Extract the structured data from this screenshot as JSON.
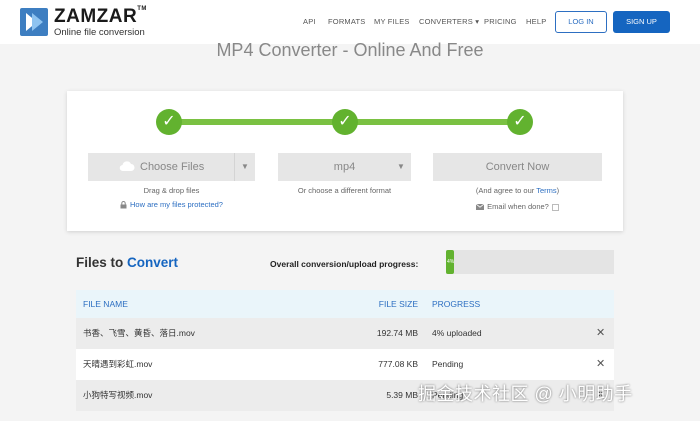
{
  "header": {
    "brand": "ZAMZAR",
    "trademark": "TM",
    "tagline": "Online file conversion",
    "nav": [
      {
        "label": "API"
      },
      {
        "label": "FORMATS"
      },
      {
        "label": "MY FILES"
      },
      {
        "label": "CONVERTERS ▾"
      },
      {
        "label": "PRICING"
      },
      {
        "label": "HELP"
      }
    ],
    "login_label": "LOG IN",
    "signup_label": "SIGN UP",
    "accent_color": "#1565c0"
  },
  "page_title": "MP4 Converter - Online And Free",
  "converter": {
    "choose_files_label": "Choose Files",
    "drag_hint": "Drag & drop files",
    "protected_link": "How are my files protected?",
    "format_value": "mp4",
    "format_hint": "Or choose a different format",
    "convert_label": "Convert Now",
    "terms_prefix": "(And agree to our ",
    "terms_link": "Terms",
    "terms_suffix": ")",
    "email_label": "Email when done?",
    "step_color": "#62b22f"
  },
  "files": {
    "heading_prefix": "Files to ",
    "heading_accent": "Convert",
    "overall_label": "Overall conversion/upload progress:",
    "overall_progress": 0.04,
    "overall_fill_text": "4%",
    "columns": {
      "name": "FILE NAME",
      "size": "FILE SIZE",
      "progress": "PROGRESS"
    },
    "rows": [
      {
        "name": "书香、飞雪、黄昏、落日.mov",
        "size": "192.74 MB",
        "progress": "4% uploaded",
        "remove": "✕"
      },
      {
        "name": "天晴遇到彩虹.mov",
        "size": "777.08 KB",
        "progress": "Pending",
        "remove": "✕"
      },
      {
        "name": "小狗特写视频.mov",
        "size": "5.39 MB",
        "progress": "Pending",
        "remove": "✕"
      }
    ]
  },
  "watermark": "掘金技术社区 @ 小明助手"
}
